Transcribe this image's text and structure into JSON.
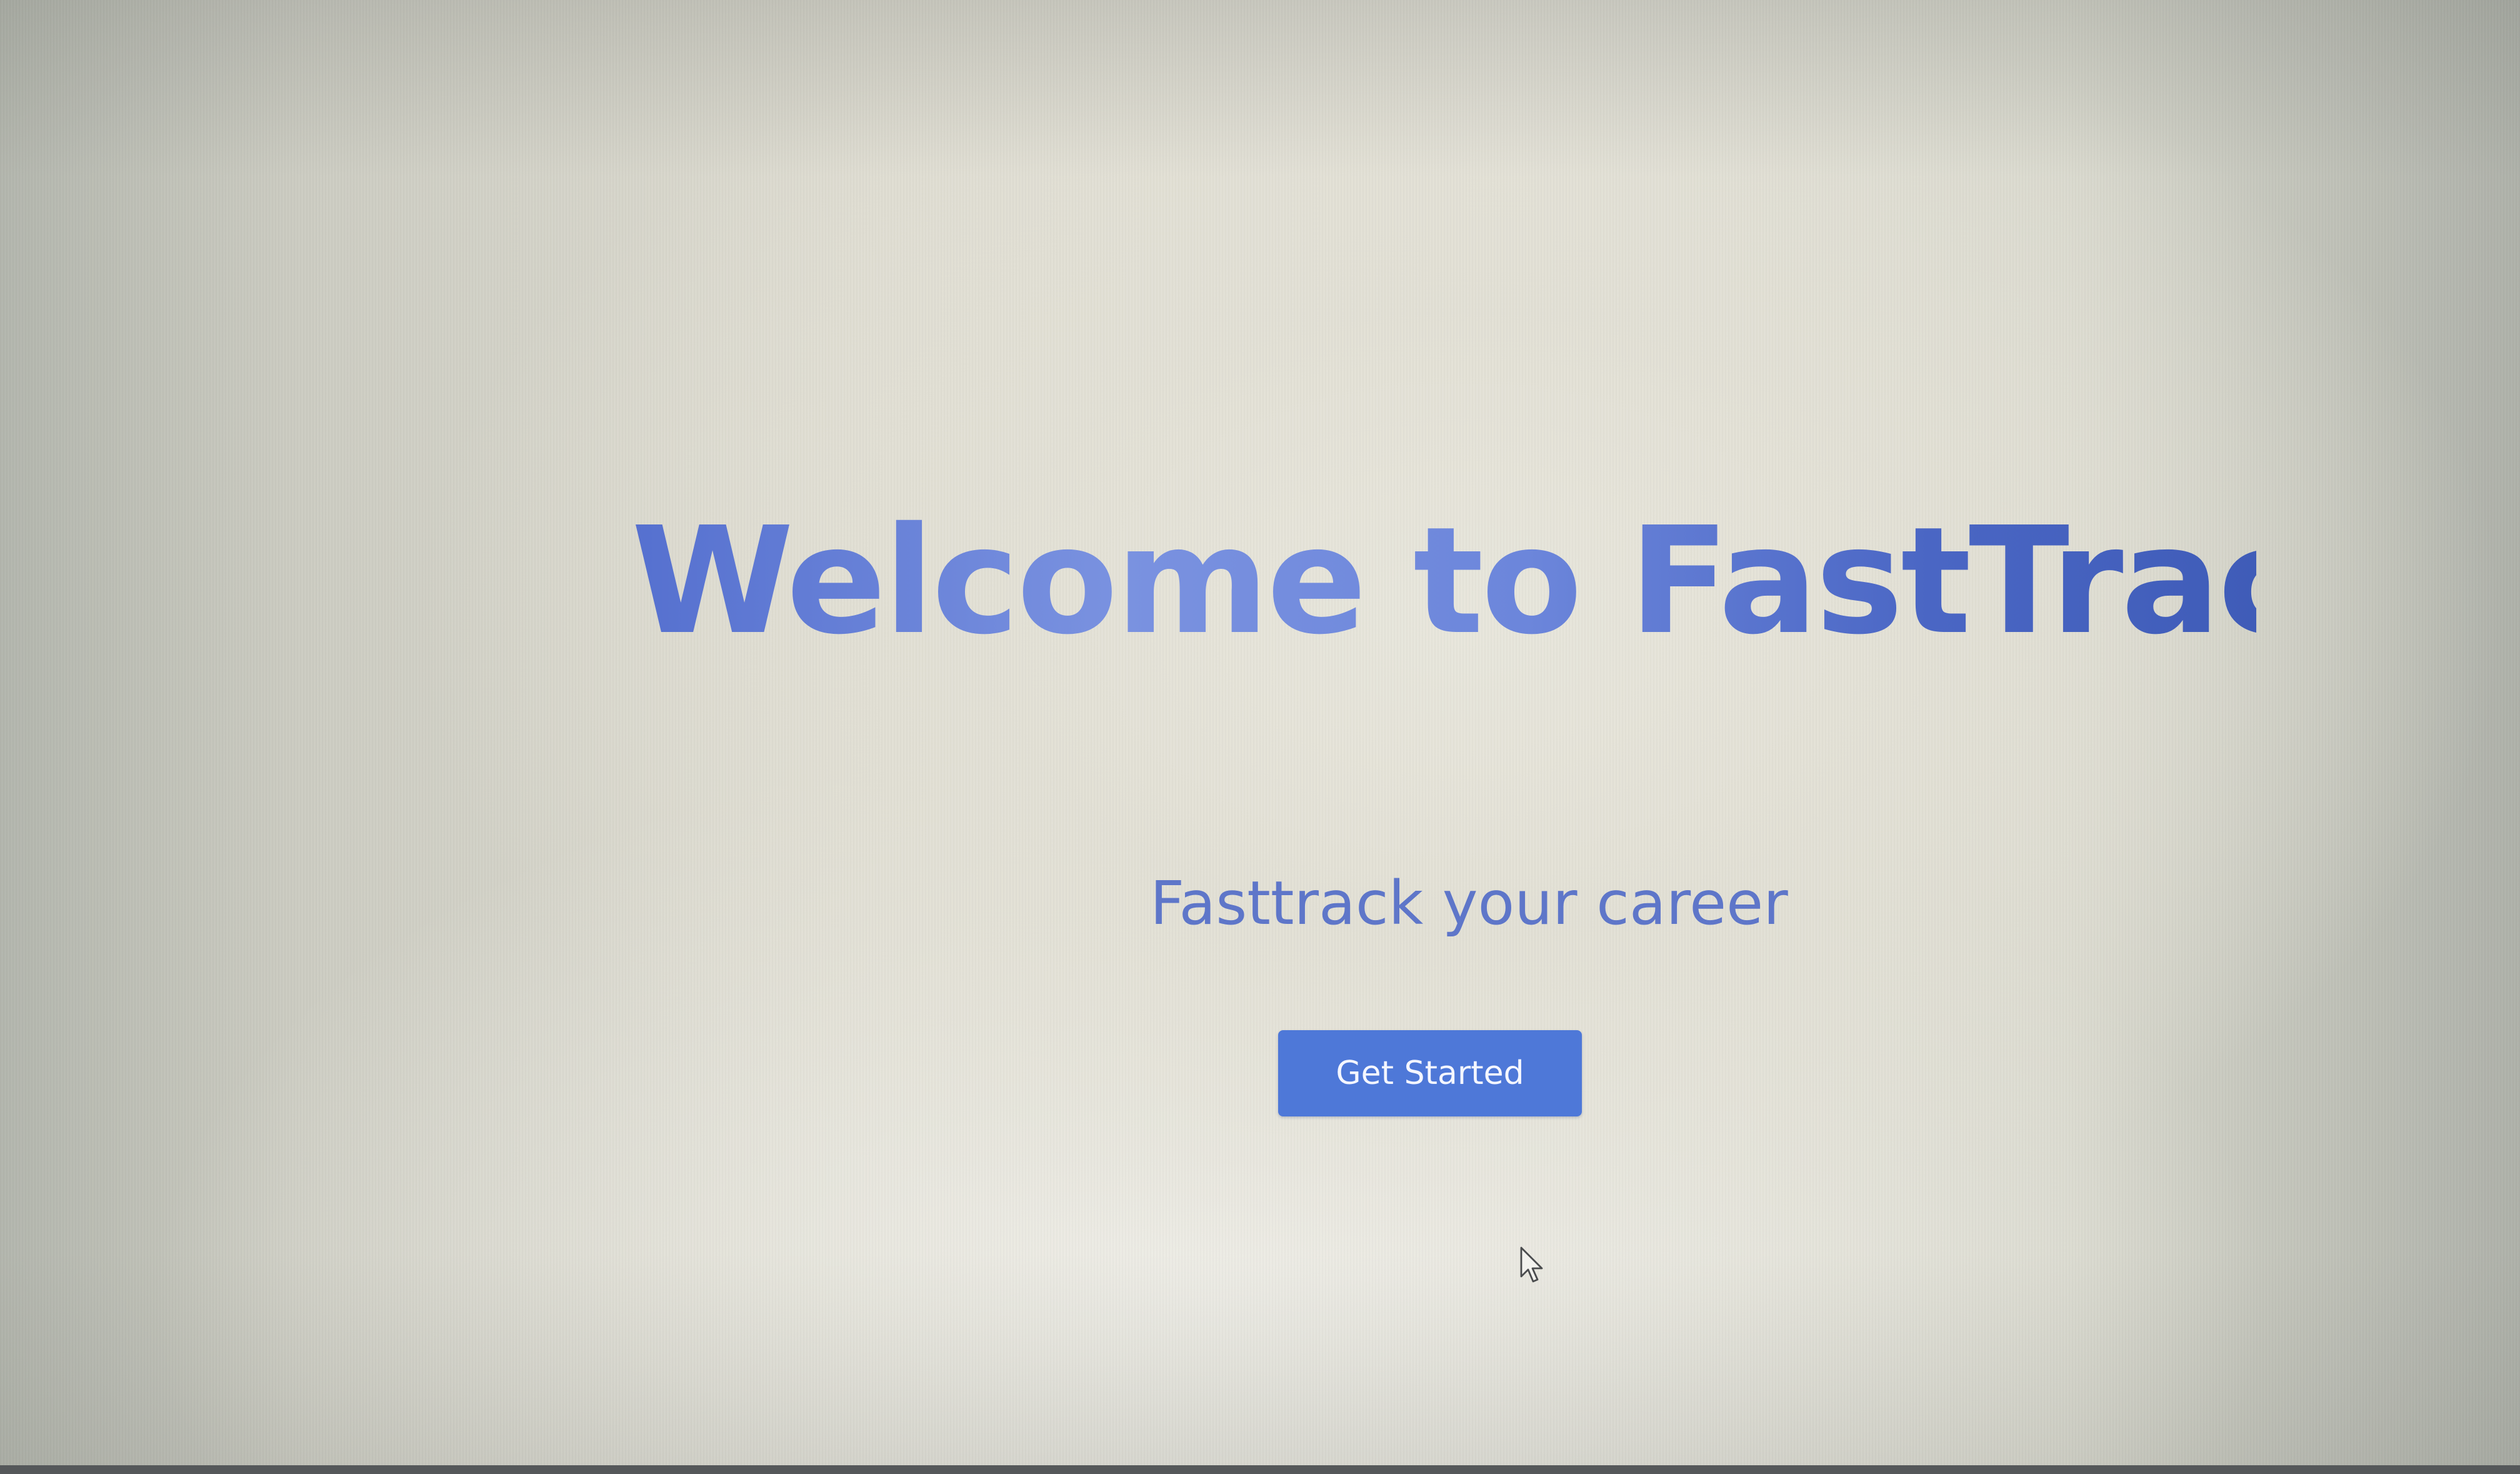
{
  "hero": {
    "title": "Welcome to FastTrack",
    "subtitle": "Fasttrack your career",
    "cta_label": "Get Started"
  },
  "colors": {
    "title_start": "#5570cf",
    "title_end": "#3f5cb8",
    "subtitle": "#5e76c9",
    "button_background": "#4e78d8",
    "button_text": "#f4f6ff"
  },
  "icons": {
    "cursor": "mouse-pointer-icon"
  }
}
